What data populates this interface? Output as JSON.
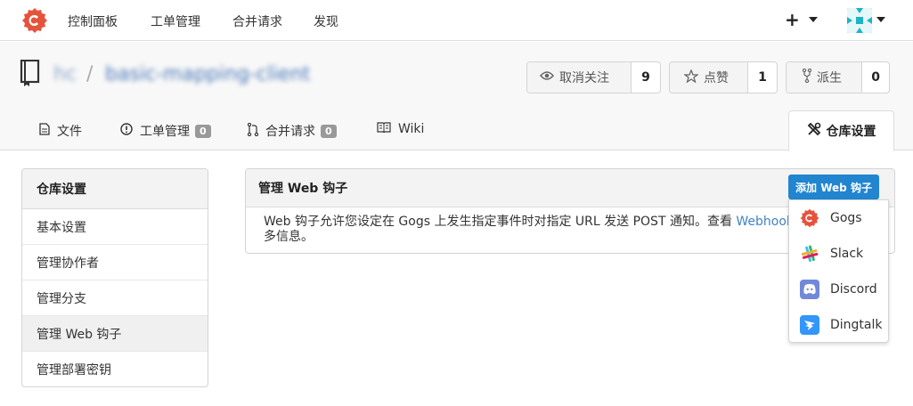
{
  "nav": {
    "items": [
      "控制面板",
      "工单管理",
      "合并请求",
      "发现"
    ],
    "plus": "+"
  },
  "repo": {
    "owner": "hc",
    "separator": "/",
    "name": "basic-mapping-client"
  },
  "stats": {
    "watch": {
      "label": "取消关注",
      "count": "9"
    },
    "star": {
      "label": "点赞",
      "count": "1"
    },
    "fork": {
      "label": "派生",
      "count": "0"
    }
  },
  "tabs": {
    "files": "文件",
    "issues": {
      "label": "工单管理",
      "count": "0"
    },
    "pulls": {
      "label": "合并请求",
      "count": "0"
    },
    "wiki": "Wiki",
    "settings": "仓库设置"
  },
  "sidebar": {
    "title": "仓库设置",
    "items": [
      "基本设置",
      "管理协作者",
      "管理分支",
      "管理 Web 钩子",
      "管理部署密钥"
    ]
  },
  "main": {
    "title": "管理 Web 钩子",
    "add_button": "添加 Web 钩子",
    "description": "Web 钩子允许您设定在 Gogs 上发生指定事件时对指定 URL 发送 POST 通知。查看 ",
    "link_text": "Webhooks",
    "description_tail": "多信息。"
  },
  "dropdown": {
    "items": [
      "Gogs",
      "Slack",
      "Discord",
      "Dingtalk"
    ]
  },
  "colors": {
    "accent": "#2185d0",
    "gogs": "#e5533c",
    "discord": "#7289da",
    "dingtalk": "#3296fa"
  },
  "icons": [
    "gogs-logo-icon",
    "avatar-icon",
    "repo-icon",
    "eye-icon",
    "star-icon",
    "fork-icon",
    "file-icon",
    "issue-icon",
    "pull-request-icon",
    "book-icon",
    "tools-icon",
    "slack-icon",
    "discord-icon",
    "dingtalk-icon"
  ]
}
